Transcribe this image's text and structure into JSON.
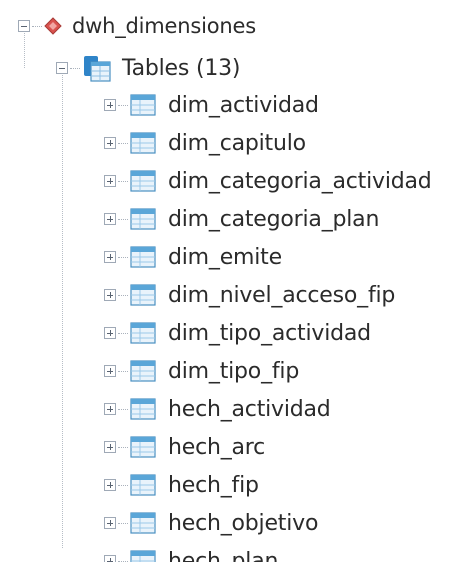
{
  "tree": {
    "database": {
      "name": "dwh_dimensiones",
      "icon": "database-diamond-icon",
      "expanded": true,
      "accent_color": "#d9534f"
    },
    "tables_folder": {
      "label": "Tables (13)",
      "icon": "tables-folder-icon",
      "expanded": true
    },
    "tables": [
      {
        "name": "dim_actividad"
      },
      {
        "name": "dim_capitulo"
      },
      {
        "name": "dim_categoria_actividad"
      },
      {
        "name": "dim_categoria_plan"
      },
      {
        "name": "dim_emite"
      },
      {
        "name": "dim_nivel_acceso_fip"
      },
      {
        "name": "dim_tipo_actividad"
      },
      {
        "name": "dim_tipo_fip"
      },
      {
        "name": "hech_actividad"
      },
      {
        "name": "hech_arc"
      },
      {
        "name": "hech_fip"
      },
      {
        "name": "hech_objetivo"
      },
      {
        "name": "hech_plan"
      }
    ],
    "colors": {
      "table_icon_fill": "#e9f3fb",
      "table_icon_header": "#5aa6d8",
      "table_icon_border": "#4a90c2",
      "text": "#2b2b2b"
    }
  }
}
